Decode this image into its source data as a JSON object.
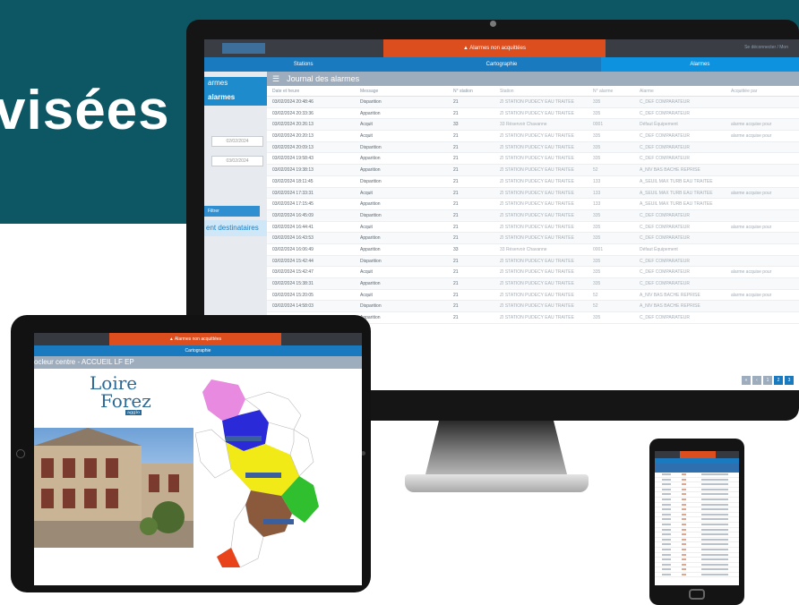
{
  "hero": {
    "title": "visées"
  },
  "desktop": {
    "alarm_banner": "Alarmes non acquittées",
    "user_text": "Se déconnecter / Mon",
    "nav": [
      "Stations",
      "Cartographie",
      "Alarmes"
    ],
    "sidebar": {
      "item_a": "armes",
      "item_b": "alarmes",
      "date_from": "02/02/2024",
      "date_to": "03/02/2024",
      "filter_button": "Filtrer",
      "destinataires": "ent destinataires"
    },
    "journal_title": "Journal des alarmes",
    "columns": [
      "Date et heure",
      "Message",
      "N° station",
      "Station",
      "N° alarme",
      "Alarme",
      "Acquittée par"
    ],
    "rows": [
      [
        "03/02/2024 20:48:46",
        "Disparition",
        "21",
        "ZI STATION PUDECY EAU TRAITEE",
        "335",
        "C_DEF COMPARATEUR",
        ""
      ],
      [
        "03/02/2024 20:33:36",
        "Apparition",
        "21",
        "ZI STATION PUDECY EAU TRAITEE",
        "335",
        "C_DEF COMPARATEUR",
        ""
      ],
      [
        "03/02/2024 20:26:13",
        "Acquit",
        "33",
        "33 Réservoir Chavanne",
        "0001",
        "Défaut Équipement",
        "alarme acquise pour"
      ],
      [
        "03/02/2024 20:20:13",
        "Acquit",
        "21",
        "ZI STATION PUDECY EAU TRAITEE",
        "335",
        "C_DEF COMPARATEUR",
        "alarme acquise pour"
      ],
      [
        "03/02/2024 20:09:13",
        "Disparition",
        "21",
        "ZI STATION PUDECY EAU TRAITEE",
        "335",
        "C_DEF COMPARATEUR",
        ""
      ],
      [
        "03/02/2024 19:58:43",
        "Apparition",
        "21",
        "ZI STATION PUDECY EAU TRAITEE",
        "335",
        "C_DEF COMPARATEUR",
        ""
      ],
      [
        "03/02/2024 19:38:13",
        "Apparition",
        "21",
        "ZI STATION PUDECY EAU TRAITEE",
        "52",
        "A_NIV BAS BACHE REPRISE",
        ""
      ],
      [
        "03/02/2024 18:11:45",
        "Disparition",
        "21",
        "ZI STATION PUDECY EAU TRAITEE",
        "133",
        "A_SEUIL MAX TURB EAU TRAITEE",
        ""
      ],
      [
        "03/02/2024 17:33:31",
        "Acquit",
        "21",
        "ZI STATION PUDECY EAU TRAITEE",
        "133",
        "A_SEUIL MAX TURB EAU TRAITEE",
        "alarme acquise pour"
      ],
      [
        "03/02/2024 17:15:45",
        "Apparition",
        "21",
        "ZI STATION PUDECY EAU TRAITEE",
        "133",
        "A_SEUIL MAX TURB EAU TRAITEE",
        ""
      ],
      [
        "03/02/2024 16:45:09",
        "Disparition",
        "21",
        "ZI STATION PUDECY EAU TRAITEE",
        "335",
        "C_DEF COMPARATEUR",
        ""
      ],
      [
        "03/02/2024 16:44:41",
        "Acquit",
        "21",
        "ZI STATION PUDECY EAU TRAITEE",
        "335",
        "C_DEF COMPARATEUR",
        "alarme acquise pour"
      ],
      [
        "03/02/2024 16:43:53",
        "Apparition",
        "21",
        "ZI STATION PUDECY EAU TRAITEE",
        "335",
        "C_DEF COMPARATEUR",
        ""
      ],
      [
        "03/02/2024 16:06:49",
        "Apparition",
        "33",
        "33 Réservoir Chavanne",
        "0001",
        "Défaut Équipement",
        ""
      ],
      [
        "03/02/2024 15:42:44",
        "Disparition",
        "21",
        "ZI STATION PUDECY EAU TRAITEE",
        "335",
        "C_DEF COMPARATEUR",
        ""
      ],
      [
        "03/02/2024 15:42:47",
        "Acquit",
        "21",
        "ZI STATION PUDECY EAU TRAITEE",
        "335",
        "C_DEF COMPARATEUR",
        "alarme acquise pour"
      ],
      [
        "03/02/2024 15:38:31",
        "Apparition",
        "21",
        "ZI STATION PUDECY EAU TRAITEE",
        "335",
        "C_DEF COMPARATEUR",
        ""
      ],
      [
        "03/02/2024 15:20:05",
        "Acquit",
        "21",
        "ZI STATION PUDECY EAU TRAITEE",
        "52",
        "A_NIV BAS BACHE REPRISE",
        "alarme acquise pour"
      ],
      [
        "03/02/2024 14:58:03",
        "Disparition",
        "21",
        "ZI STATION PUDECY EAU TRAITEE",
        "52",
        "A_NIV BAS BACHE REPRISE",
        ""
      ],
      [
        "03/02/2024 14:51:12",
        "Apparition",
        "21",
        "ZI STATION PUDECY EAU TRAITEE",
        "335",
        "C_DEF COMPARATEUR",
        ""
      ]
    ],
    "pager": [
      "«",
      "‹",
      "1",
      "2",
      "3"
    ]
  },
  "tablet": {
    "alarm_banner": "Alarmes non acquittées",
    "nav": "Cartographie",
    "title": "ocleur centre - ACCUEIL LF EP",
    "logo": {
      "line1": "Loire",
      "line2": "Forez",
      "line3": "agglo"
    }
  },
  "colors": {
    "accent": "#dd4e1e",
    "brand": "#1a7ac0",
    "teal": "#0d5663"
  }
}
